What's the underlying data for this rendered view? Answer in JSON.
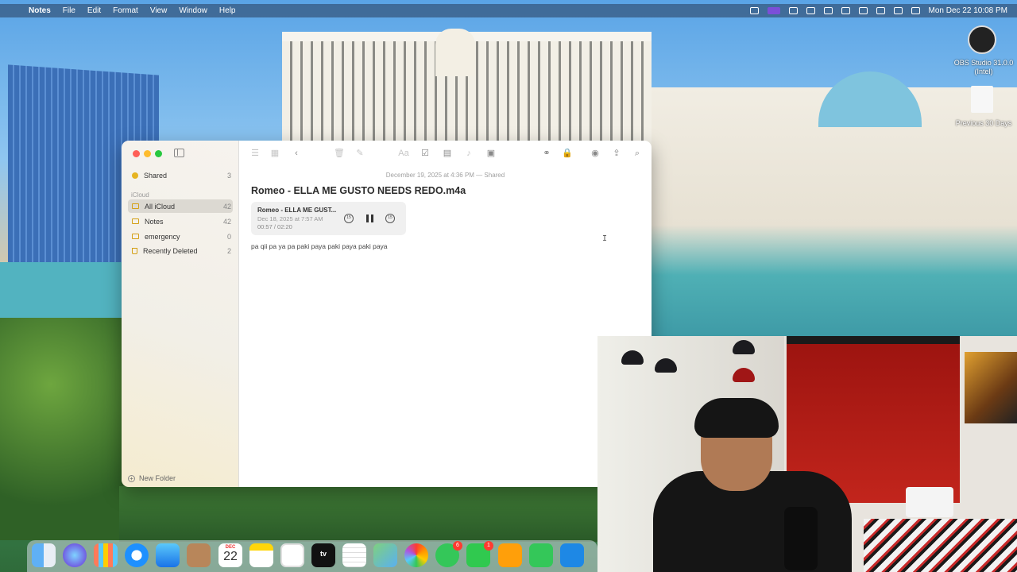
{
  "menubar": {
    "app": "Notes",
    "items": [
      "File",
      "Edit",
      "Format",
      "View",
      "Window",
      "Help"
    ],
    "clock": "Mon Dec 22  10:08 PM"
  },
  "desktop": {
    "obs_label": "OBS Studio 31.0.0 (Intel)",
    "doc_label": "Previous 30 Days"
  },
  "sidebar": {
    "shared": {
      "label": "Shared",
      "count": "3"
    },
    "section": "iCloud",
    "folders": [
      {
        "label": "All iCloud",
        "count": "42"
      },
      {
        "label": "Notes",
        "count": "42"
      },
      {
        "label": "emergency",
        "count": "0"
      },
      {
        "label": "Recently Deleted",
        "count": "2"
      }
    ],
    "new_folder": "New Folder"
  },
  "note": {
    "date": "December 19, 2025 at 4:36 PM — Shared",
    "title": "Romeo - ELLA ME GUSTO NEEDS REDO.m4a",
    "body": "pa qii pa ya pa paki  paya paki paya paki paya"
  },
  "audio": {
    "title": "Romeo - ELLA ME GUST...",
    "date": "Dec 18, 2025 at 7:57 AM",
    "time": "00:57 / 02:20",
    "skip_back": "15",
    "skip_fwd": "15"
  },
  "dock": {
    "calendar_month": "DEC",
    "calendar_day": "22",
    "tv_label": "tv",
    "messages_badge": "6",
    "facetime_badge": "1"
  },
  "colors": {
    "close": "#fe5f57",
    "minimize": "#febc2e",
    "zoom": "#28c840",
    "folder_accent": "#d4a017"
  }
}
